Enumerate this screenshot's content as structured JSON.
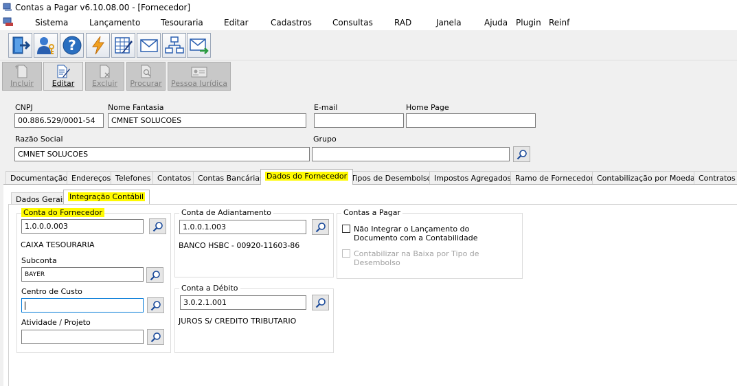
{
  "window": {
    "title": "Contas a Pagar v6.10.08.00 - [Fornecedor]"
  },
  "menu": [
    "Sistema",
    "Lançamento",
    "Tesouraria",
    "Editar",
    "Cadastros",
    "Consultas",
    "RAD",
    "Janela",
    "Ajuda",
    "Plugin",
    "Reinf"
  ],
  "toolbar1": {
    "icons": [
      "exit-icon",
      "user-key-icon",
      "help-icon",
      "lightning-icon",
      "spreadsheet-edit-icon",
      "envelope-icon",
      "hierarchy-icon",
      "envelope-send-icon"
    ]
  },
  "toolbar2": {
    "buttons": [
      {
        "label": "Incluir",
        "enabled": false
      },
      {
        "label": "Editar",
        "enabled": true
      },
      {
        "label": "Excluir",
        "enabled": false
      },
      {
        "label": "Procurar",
        "enabled": false
      },
      {
        "label": "Pessoa Jurídica",
        "enabled": false
      }
    ]
  },
  "form": {
    "cnpj_label": "CNPJ",
    "cnpj_value": "00.886.529/0001-54",
    "nome_fantasia_label": "Nome Fantasia",
    "nome_fantasia_value": "CMNET SOLUCOES",
    "email_label": "E-mail",
    "email_value": "",
    "homepage_label": "Home Page",
    "homepage_value": "",
    "razao_social_label": "Razão Social",
    "razao_social_value": "CMNET SOLUCOES",
    "grupo_label": "Grupo",
    "grupo_value": ""
  },
  "tabs": {
    "items": [
      "Documentação",
      "Endereços",
      "Telefones",
      "Contatos",
      "Contas Bancárias",
      "Dados do Fornecedor",
      "Tipos de Desembolso",
      "Impostos Agregados",
      "Ramo de Fornecedor",
      "Contabilização por Moeda",
      "Contratos"
    ],
    "active": "Dados do Fornecedor"
  },
  "subtabs": {
    "items": [
      "Dados Gerais",
      "Integração Contábil"
    ],
    "active": "Integração Contábil"
  },
  "conta_fornecedor": {
    "title": "Conta do Fornecedor",
    "value": "1.0.0.0.003",
    "description": "CAIXA TESOURARIA",
    "subconta_label": "Subconta",
    "subconta_value": "BAYER",
    "centro_custo_label": "Centro de Custo",
    "centro_custo_value": "",
    "atividade_label": "Atividade / Projeto",
    "atividade_value": ""
  },
  "conta_adiantamento": {
    "title": "Conta de Adiantamento",
    "value": "1.0.0.1.003",
    "description": "BANCO HSBC - 00920-11603-86"
  },
  "conta_debito": {
    "title": "Conta a Débito",
    "value": "3.0.2.1.001",
    "description": "JUROS S/ CREDITO TRIBUTARIO"
  },
  "contas_pagar": {
    "title": "Contas a Pagar",
    "check1_line1": "Não Integrar o Lançamento do",
    "check1_line2": "Documento com a Contabilidade",
    "check1_checked": false,
    "check2_line1": "Contabilizar na Baixa por Tipo de",
    "check2_line2": "Desembolso",
    "check2_checked": false,
    "check2_enabled": false
  },
  "colors": {
    "highlight": "#fffa00",
    "window_bg": "#f0f0f0",
    "focus_border": "#0078d7"
  }
}
